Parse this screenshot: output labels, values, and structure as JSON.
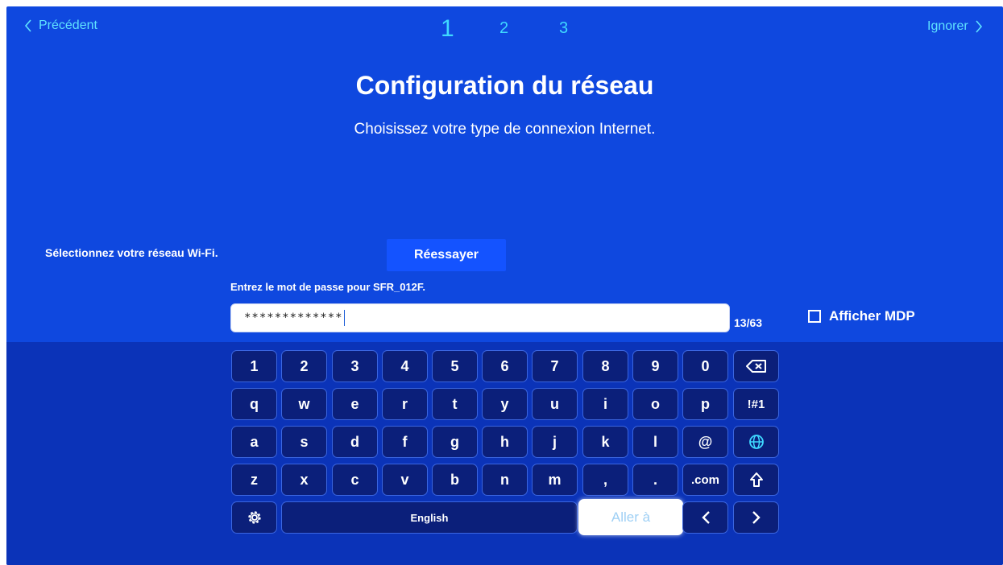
{
  "nav": {
    "back_label": "Précédent",
    "skip_label": "Ignorer",
    "steps": [
      "1",
      "2",
      "3"
    ],
    "active_step": 1
  },
  "header": {
    "title": "Configuration du réseau",
    "subtitle": "Choisissez votre type de connexion Internet."
  },
  "wifi": {
    "select_label": "Sélectionnez votre réseau Wi-Fi.",
    "retry_label": "Réessayer"
  },
  "password": {
    "prompt": "Entrez le mot de passe pour SFR_012F.",
    "masked_value": "*************",
    "char_count": "13/63",
    "show_label": "Afficher MDP",
    "show_checked": false
  },
  "keyboard": {
    "row1": [
      "1",
      "2",
      "3",
      "4",
      "5",
      "6",
      "7",
      "8",
      "9",
      "0"
    ],
    "row2": [
      "q",
      "w",
      "e",
      "r",
      "t",
      "y",
      "u",
      "i",
      "o",
      "p"
    ],
    "row3": [
      "a",
      "s",
      "d",
      "f",
      "g",
      "h",
      "j",
      "k",
      "l",
      "@"
    ],
    "row4": [
      "z",
      "x",
      "c",
      "v",
      "b",
      "n",
      "m",
      ",",
      ".",
      ".com"
    ],
    "symbols_label": "!#1",
    "space_label": "English",
    "go_label": "Aller à",
    "icons": {
      "backspace": "backspace-icon",
      "language": "globe-icon",
      "shift": "shift-up-arrow-icon",
      "settings": "gear-icon",
      "left": "chevron-left-icon",
      "right": "chevron-right-icon"
    }
  },
  "colors": {
    "background": "#0f48df",
    "keyboard_area": "#0b33b8",
    "key_fill": "#0b1f7a",
    "key_border": "#3b66e0",
    "accent_cyan": "#3fd9ff"
  }
}
